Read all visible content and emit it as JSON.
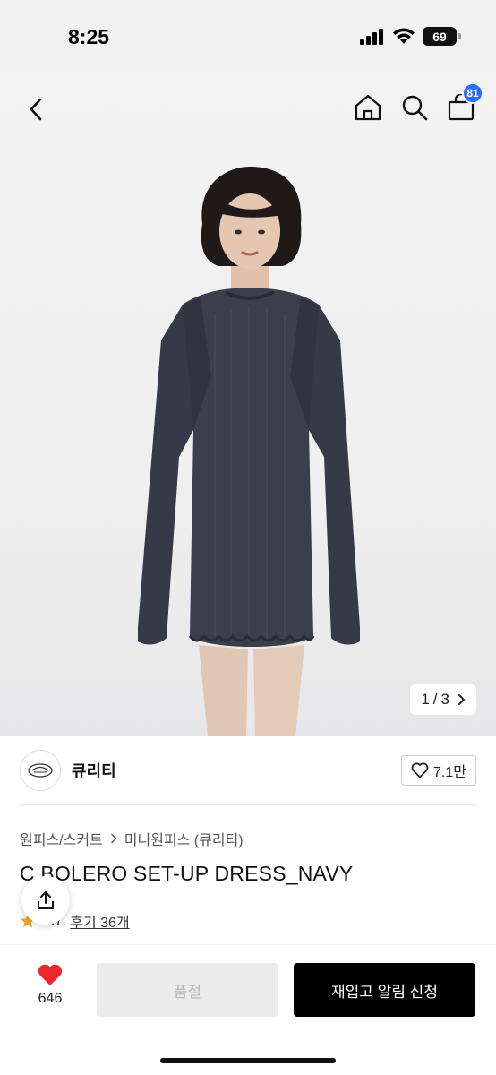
{
  "status": {
    "time": "8:25",
    "battery": "69"
  },
  "nav": {
    "cart_count": "81"
  },
  "gallery": {
    "current": "1",
    "separator": "/",
    "total": "3"
  },
  "brand": {
    "name": "큐리티",
    "likes": "7.1만"
  },
  "breadcrumb": [
    "원피스/스커트",
    "미니원피스 (큐리티)"
  ],
  "product": {
    "title": "C BOLERO SET-UP DRESS_NAVY",
    "rating": "4.7",
    "reviews": "후기 36개"
  },
  "bottom": {
    "like_count": "646",
    "soldout_label": "품절",
    "restock_label": "재입고 알림 신청"
  },
  "colors": {
    "accent_badge": "#2f6cf6",
    "sweater": "#3b3f4c",
    "primary_button": "#000000"
  },
  "icons": [
    "back-icon",
    "home-icon",
    "search-icon",
    "cart-icon",
    "chevron-right-icon",
    "heart-outline-icon",
    "share-icon",
    "star-icon",
    "heart-filled-icon"
  ]
}
